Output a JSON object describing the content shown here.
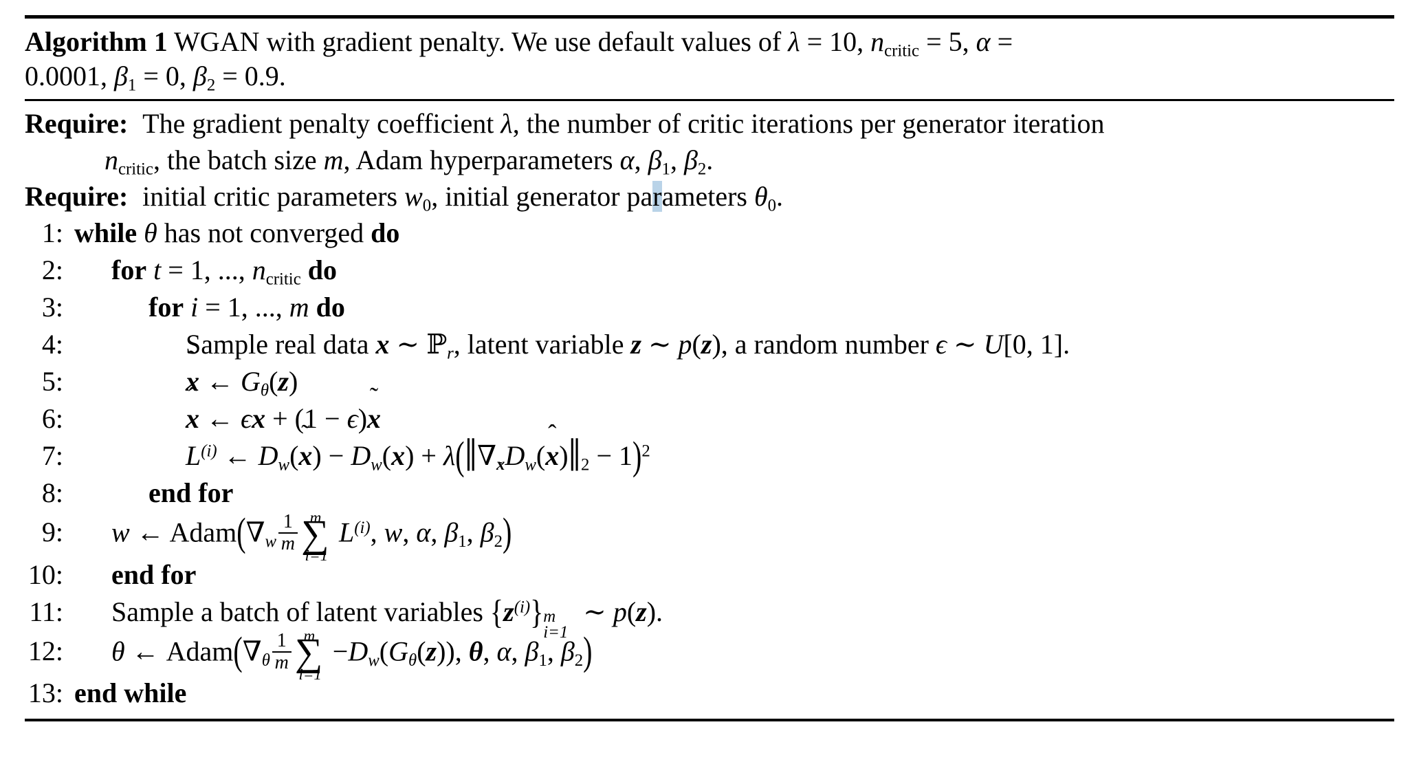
{
  "algorithm": {
    "label": "Algorithm 1",
    "caption_text": "WGAN with gradient penalty. We use default values of",
    "caption_defaults": "λ = 10, n_critic = 5, α = 0.0001, β₁ = 0, β₂ = 0.9.",
    "lambda_symbol": "λ",
    "lambda_value": "10",
    "n_critic_value": "5",
    "alpha_value": "0.0001",
    "beta1_value": "0",
    "beta2_value": "0.9",
    "requires": [
      {
        "label": "Require:",
        "text_part_1": "The gradient penalty coefficient",
        "symbol_1": "λ",
        "text_part_2": ", the number of critic iterations per generator iteration",
        "continuation_prefix": "n_critic",
        "continuation_text_1": ", the batch size",
        "continuation_symbol": "m",
        "continuation_text_2": ", Adam hyperparameters",
        "continuation_params": "α, β₁, β₂."
      },
      {
        "label": "Require:",
        "text_part_1": "initial critic parameters",
        "symbol_1": "w₀",
        "text_part_2": ", initial generator parameters",
        "symbol_2": "θ₀",
        "text_part_3": "."
      }
    ],
    "steps": [
      {
        "number": "1:",
        "indent": 0,
        "kind": "while",
        "keyword_open": "while",
        "condition_symbol": "θ",
        "condition_text": "has not converged",
        "keyword_close": "do",
        "plain": "while θ has not converged do"
      },
      {
        "number": "2:",
        "indent": 1,
        "kind": "for",
        "keyword_open": "for",
        "var": "t",
        "range": "= 1, ..., n_critic",
        "keyword_close": "do",
        "plain": "for t = 1, ..., n_critic do"
      },
      {
        "number": "3:",
        "indent": 2,
        "kind": "for",
        "keyword_open": "for",
        "var": "i",
        "range": "= 1, ..., m",
        "keyword_close": "do",
        "plain": "for i = 1, ..., m do"
      },
      {
        "number": "4:",
        "indent": 3,
        "kind": "statement",
        "plain": "Sample real data x ~ P_r, latent variable z ~ p(z), a random number ε ~ U[0, 1].",
        "text_1": "Sample real data",
        "text_2": ", latent variable",
        "text_3": ", a random number",
        "distribution_real": "P_r",
        "distribution_latent": "p(z)",
        "distribution_epsilon": "U[0, 1]"
      },
      {
        "number": "5:",
        "indent": 3,
        "kind": "assign",
        "plain": "x̃ ← G_θ(z)"
      },
      {
        "number": "6:",
        "indent": 3,
        "kind": "assign",
        "plain": "x̂ ← εx + (1 − ε)x̃"
      },
      {
        "number": "7:",
        "indent": 3,
        "kind": "assign",
        "plain": "L^(i) ← D_w(x̃) − D_w(x) + λ(‖∇_x̂ D_w(x̂)‖₂ − 1)²"
      },
      {
        "number": "8:",
        "indent": 2,
        "kind": "end",
        "plain": "end for"
      },
      {
        "number": "9:",
        "indent": 1,
        "kind": "assign",
        "plain": "w ← Adam(∇_w (1/m) Σ_{i=1}^{m} L^(i), w, α, β₁, β₂)",
        "optimizer": "Adam"
      },
      {
        "number": "10:",
        "indent": 1,
        "kind": "end",
        "plain": "end for"
      },
      {
        "number": "11:",
        "indent": 1,
        "kind": "statement",
        "plain": "Sample a batch of latent variables {z^(i)}_{i=1}^{m} ~ p(z).",
        "text_1": "Sample a batch of latent variables"
      },
      {
        "number": "12:",
        "indent": 1,
        "kind": "assign",
        "plain": "θ ← Adam(∇_θ (1/m) Σ_{i=1}^{m} −D_w(G_θ(z)), θ, α, β₁, β₂)",
        "optimizer": "Adam"
      },
      {
        "number": "13:",
        "indent": 0,
        "kind": "end",
        "keyword": "end while",
        "plain": "end while"
      }
    ]
  }
}
